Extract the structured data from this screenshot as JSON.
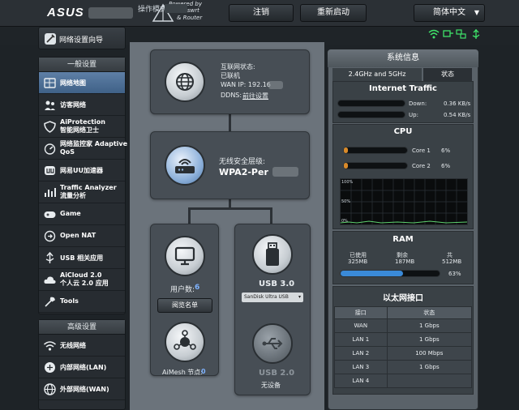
{
  "header": {
    "brand": "ASUS",
    "tagline": [
      "Powered by",
      "Asuswrt",
      "& Router"
    ],
    "logout": "注销",
    "reboot": "重新启动",
    "language": "简体中文"
  },
  "status_bar": {
    "mode_label": "操作模式: 无"
  },
  "sidebar": {
    "quick_setup": "网络设置向导",
    "general_title": "一般设置",
    "general_items": [
      {
        "label": "网络地图",
        "icon": "map-icon",
        "active": true
      },
      {
        "label": "访客网络",
        "icon": "guest-icon"
      },
      {
        "label": "AiProtection",
        "label2": "智能网络卫士",
        "icon": "shield-icon"
      },
      {
        "label": "网络监控家 Adaptive",
        "label2": "QoS",
        "icon": "qos-icon"
      },
      {
        "label": "网易UU加速器",
        "icon": "uu-icon"
      },
      {
        "label": "Traffic Analyzer",
        "label2": "流量分析",
        "icon": "chart-icon"
      },
      {
        "label": "Game",
        "icon": "gamepad-icon"
      },
      {
        "label": "Open NAT",
        "icon": "nat-icon"
      },
      {
        "label": "USB 相关应用",
        "icon": "usb-icon"
      },
      {
        "label": "AiCloud 2.0",
        "label2": "个人云 2.0 应用",
        "icon": "cloud-icon"
      },
      {
        "label": "Tools",
        "icon": "tools-icon"
      }
    ],
    "advanced_title": "高级设置",
    "advanced_items": [
      {
        "label": "无线网络",
        "icon": "wifi-icon"
      },
      {
        "label": "内部网络(LAN)",
        "icon": "lan-icon"
      },
      {
        "label": "外部网络(WAN)",
        "icon": "wan-icon"
      }
    ]
  },
  "network_map": {
    "internet": {
      "status_label": "互联网状态:",
      "status_value": "已联机",
      "wan_ip": "WAN IP: 192.16",
      "ddns": "DDNS:",
      "ddns_link": "前往设置"
    },
    "wireless": {
      "security_label": "无线安全层级:",
      "security_value": "WPA2-Per"
    },
    "clients": {
      "label": "用户数:",
      "count": "6",
      "view_list": "阅览名单"
    },
    "aimesh": {
      "label": "AiMesh 节点:",
      "count": "0"
    },
    "usb3": {
      "title": "USB 3.0",
      "device": "SanDisk Ultra USB"
    },
    "usb2": {
      "title": "USB 2.0",
      "device": "无设备"
    }
  },
  "system_status": {
    "title": "系统信息",
    "tabs": [
      "2.4GHz and 5GHz",
      "状态"
    ],
    "internet_traffic": {
      "title": "Internet Traffic",
      "down_label": "Down:",
      "down_value": "0.36 KB/s",
      "up_label": "Up:",
      "up_value": "0.54 KB/s"
    },
    "cpu": {
      "title": "CPU",
      "cores": [
        {
          "label": "Core 1",
          "value": "6%",
          "level": 0.06
        },
        {
          "label": "Core 2",
          "value": "6%",
          "level": 0.06
        }
      ],
      "graph_labels": [
        "100%",
        "50%",
        "0%"
      ]
    },
    "ram": {
      "title": "RAM",
      "headers": [
        "已使用",
        "剩余",
        "共"
      ],
      "values": [
        "325MB",
        "187MB",
        "512MB"
      ],
      "percent": "63%",
      "level": 0.63
    },
    "ethernet": {
      "title": "以太网接口",
      "headers": [
        "接口",
        "状态"
      ],
      "rows": [
        [
          "WAN",
          "1 Gbps"
        ],
        [
          "LAN 1",
          "1 Gbps"
        ],
        [
          "LAN 2",
          "100 Mbps"
        ],
        [
          "LAN 3",
          "1 Gbps"
        ],
        [
          "LAN 4",
          ""
        ]
      ]
    }
  }
}
